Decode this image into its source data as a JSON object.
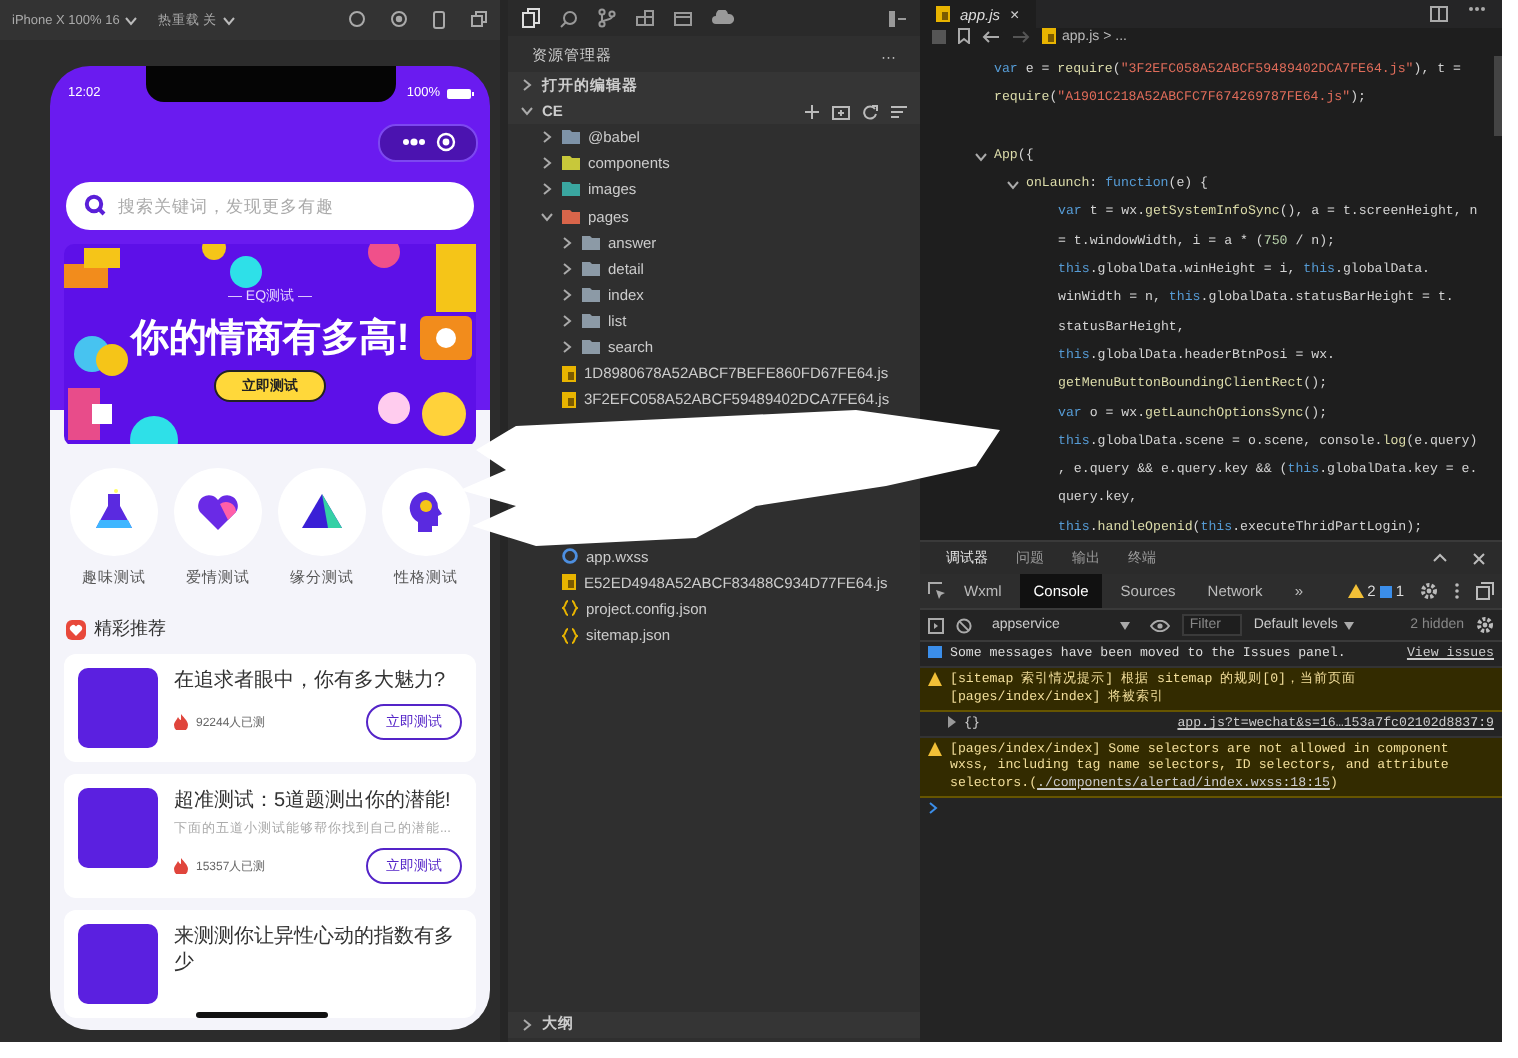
{
  "simulator": {
    "toolbar": [
      {
        "label": "iPhone X 100% 16"
      },
      {
        "label": "热重载 关"
      }
    ],
    "phone": {
      "time": "12:02",
      "battery": "100%",
      "search_placeholder": "搜索关键词，发现更多有趣",
      "banner": {
        "subtitle": "— EQ测试 —",
        "title": "你的情商有多高!",
        "button": "立即测试"
      },
      "categories": [
        {
          "kind": "flask",
          "label": "趣味测试"
        },
        {
          "kind": "heart",
          "label": "爱情测试"
        },
        {
          "kind": "triangle",
          "label": "缘分测试"
        },
        {
          "kind": "head",
          "label": "性格测试"
        }
      ],
      "section_title": "精彩推荐",
      "cards": [
        {
          "title": "在追求者眼中，你有多大魅力?",
          "count": "92244人已测",
          "button": "立即测试"
        },
        {
          "title": "超准测试：5道题测出你的潜能!",
          "description": "下面的五道小测试能够帮你找到自己的潜能...",
          "count": "15357人已测",
          "button": "立即测试"
        },
        {
          "title": "来测测你让异性心动的指数有多少"
        }
      ]
    }
  },
  "explorer": {
    "title": "资源管理器",
    "more": "···",
    "sections": [
      {
        "label": "打开的编辑器",
        "expanded": false
      },
      {
        "label": "CE",
        "expanded": true,
        "children": [
          {
            "name": "@babel",
            "kind": "folder",
            "color": "#7e93a8",
            "expanded": false
          },
          {
            "name": "components",
            "kind": "folder",
            "color": "#c8c83a",
            "expanded": false
          },
          {
            "name": "images",
            "kind": "folder",
            "color": "#3aa6a0",
            "expanded": false
          },
          {
            "name": "pages",
            "kind": "folder",
            "color": "#d9654a",
            "expanded": true,
            "children": [
              {
                "name": "answer",
                "kind": "folder",
                "color": "#8c9aa6",
                "expanded": false
              },
              {
                "name": "detail",
                "kind": "folder",
                "color": "#8c9aa6",
                "expanded": false
              },
              {
                "name": "index",
                "kind": "folder",
                "color": "#8c9aa6",
                "expanded": false
              },
              {
                "name": "list",
                "kind": "folder",
                "color": "#8c9aa6",
                "expanded": false
              },
              {
                "name": "search",
                "kind": "folder",
                "color": "#8c9aa6",
                "expanded": false
              }
            ]
          },
          {
            "name": "1D8980678A52ABCF7BEFE860FD67FE64.js",
            "kind": "js"
          },
          {
            "name": "3F2EFC058A52ABCF59489402DCA7FE64.js",
            "kind": "js"
          },
          {
            "kind": "redacted"
          },
          {
            "name": "app.wxss",
            "kind": "wxss"
          },
          {
            "name": "E52ED4948A52ABCF83488C934D77FE64.js",
            "kind": "js"
          },
          {
            "name": "project.config.json",
            "kind": "json"
          },
          {
            "name": "sitemap.json",
            "kind": "json"
          }
        ]
      }
    ],
    "outline": {
      "label": "大纲",
      "expanded": false
    }
  },
  "editor": {
    "tab": "app.js",
    "close": "×",
    "breadcrumb": "app.js > ...",
    "lines": [
      {
        "kind": "code",
        "tokens": [
          {
            "kind": "kw",
            "t": "var"
          },
          {
            "kind": "p",
            "t": " e = "
          },
          {
            "kind": "fn",
            "t": "require"
          },
          {
            "kind": "p",
            "t": "("
          },
          {
            "kind": "str",
            "t": "\"3F2EFC058A52ABCF59489402DCA7FE64.js\""
          },
          {
            "kind": "p",
            "t": "), t ="
          }
        ]
      },
      {
        "kind": "code",
        "tokens": [
          {
            "kind": "fn",
            "t": "require"
          },
          {
            "kind": "p",
            "t": "("
          },
          {
            "kind": "str",
            "t": "\"A1901C218A52ABCFC7F674269787FE64.js\""
          },
          {
            "kind": "p",
            "t": ");"
          }
        ]
      },
      {
        "kind": "blank"
      },
      {
        "kind": "code",
        "expanded": true,
        "tokens": [
          {
            "kind": "fn",
            "t": "App"
          },
          {
            "kind": "p",
            "t": "({"
          }
        ],
        "children": [
          {
            "kind": "code",
            "expanded": true,
            "tokens": [
              {
                "kind": "prop",
                "t": "onLaunch"
              },
              {
                "kind": "p",
                "t": ": "
              },
              {
                "kind": "kw",
                "t": "function"
              },
              {
                "kind": "p",
                "t": "(e) {"
              }
            ],
            "children": [
              {
                "kind": "code",
                "tokens": [
                  {
                    "kind": "kw",
                    "t": "var"
                  },
                  {
                    "kind": "p",
                    "t": " t = wx."
                  },
                  {
                    "kind": "fn",
                    "t": "getSystemInfoSync"
                  },
                  {
                    "kind": "p",
                    "t": "(), a = t.screenHeight, n"
                  }
                ]
              },
              {
                "kind": "code",
                "tokens": [
                  {
                    "kind": "p",
                    "t": "= t.windowWidth, i = a * ("
                  },
                  {
                    "kind": "num",
                    "t": "750"
                  },
                  {
                    "kind": "p",
                    "t": " / n);"
                  }
                ]
              },
              {
                "kind": "code",
                "tokens": [
                  {
                    "kind": "kw",
                    "t": "this"
                  },
                  {
                    "kind": "p",
                    "t": ".globalData.winHeight = i, "
                  },
                  {
                    "kind": "kw",
                    "t": "this"
                  },
                  {
                    "kind": "p",
                    "t": ".globalData."
                  }
                ]
              },
              {
                "kind": "code",
                "tokens": [
                  {
                    "kind": "p",
                    "t": "winWidth = n, "
                  },
                  {
                    "kind": "kw",
                    "t": "this"
                  },
                  {
                    "kind": "p",
                    "t": ".globalData.statusBarHeight = t."
                  }
                ]
              },
              {
                "kind": "code",
                "tokens": [
                  {
                    "kind": "p",
                    "t": "statusBarHeight,"
                  }
                ]
              },
              {
                "kind": "code",
                "tokens": [
                  {
                    "kind": "kw",
                    "t": "this"
                  },
                  {
                    "kind": "p",
                    "t": ".globalData.headerBtnPosi = wx."
                  }
                ]
              },
              {
                "kind": "code",
                "tokens": [
                  {
                    "kind": "fn",
                    "t": "getMenuButtonBoundingClientRect"
                  },
                  {
                    "kind": "p",
                    "t": "();"
                  }
                ]
              },
              {
                "kind": "code",
                "tokens": [
                  {
                    "kind": "kw",
                    "t": "var"
                  },
                  {
                    "kind": "p",
                    "t": " o = wx."
                  },
                  {
                    "kind": "fn",
                    "t": "getLaunchOptionsSync"
                  },
                  {
                    "kind": "p",
                    "t": "();"
                  }
                ]
              },
              {
                "kind": "code",
                "tokens": [
                  {
                    "kind": "kw",
                    "t": "this"
                  },
                  {
                    "kind": "p",
                    "t": ".globalData.scene = o.scene, console."
                  },
                  {
                    "kind": "fn",
                    "t": "log"
                  },
                  {
                    "kind": "p",
                    "t": "(e.query)"
                  }
                ]
              },
              {
                "kind": "code",
                "tokens": [
                  {
                    "kind": "p",
                    "t": ", e.query && e.query.key && ("
                  },
                  {
                    "kind": "kw",
                    "t": "this"
                  },
                  {
                    "kind": "p",
                    "t": ".globalData.key = e."
                  }
                ]
              },
              {
                "kind": "code",
                "tokens": [
                  {
                    "kind": "p",
                    "t": "query.key,"
                  }
                ]
              },
              {
                "kind": "code",
                "tokens": [
                  {
                    "kind": "kw",
                    "t": "this"
                  },
                  {
                    "kind": "p",
                    "t": "."
                  },
                  {
                    "kind": "fn",
                    "t": "handleOpenid"
                  },
                  {
                    "kind": "p",
                    "t": "("
                  },
                  {
                    "kind": "kw",
                    "t": "this"
                  },
                  {
                    "kind": "p",
                    "t": ".executeThridPartLogin);"
                  }
                ]
              }
            ]
          }
        ]
      }
    ]
  },
  "console": {
    "panel_tabs": [
      {
        "label": "调试器",
        "selected": true
      },
      {
        "label": "问题",
        "selected": false
      },
      {
        "label": "输出",
        "selected": false
      },
      {
        "label": "终端",
        "selected": false
      }
    ],
    "tool_tabs": [
      {
        "label": "Wxml",
        "selected": false
      },
      {
        "label": "Console",
        "selected": true
      },
      {
        "label": "Sources",
        "selected": false
      },
      {
        "label": "Network",
        "selected": false
      }
    ],
    "more": "»",
    "warning_count": "2",
    "info_count": "1",
    "context": "appservice",
    "filter_placeholder": "Filter",
    "levels": "Default levels",
    "hidden": "2 hidden",
    "messages": [
      {
        "kind": "info",
        "text": "Some messages have been moved to the Issues panel.",
        "link": "View issues"
      },
      {
        "kind": "warning",
        "text": "[sitemap 索引情况提示] 根据 sitemap 的规则[0]，当前页面 [pages/index/index] 将被索引"
      },
      {
        "kind": "log",
        "text": "{}",
        "link": "app.js?t=wechat&s=16…153a7fc02102d8837:9"
      },
      {
        "kind": "warning",
        "text": "[pages/index/index] Some selectors are not allowed in component wxss, including tag name selectors, ID selectors, and attribute selectors.(",
        "link": "./components/alertad/index.wxss:18:15",
        "after": ")"
      }
    ]
  },
  "redaction_mark": true
}
